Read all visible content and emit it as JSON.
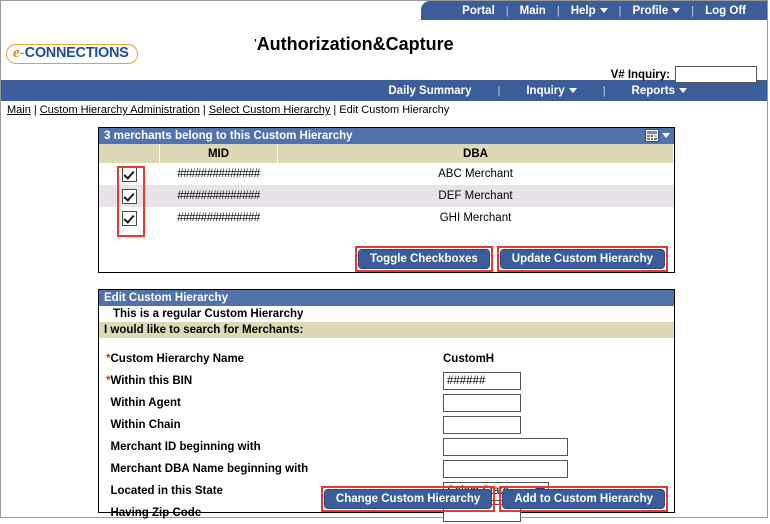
{
  "topnav": {
    "items": [
      {
        "label": "Portal",
        "caret": false
      },
      {
        "label": "Main",
        "caret": false
      },
      {
        "label": "Help",
        "caret": true
      },
      {
        "label": "Profile",
        "caret": true
      },
      {
        "label": "Log Off",
        "caret": false
      }
    ],
    "separator": "|"
  },
  "brand": {
    "logo_prefix": "e-",
    "logo_word": "CONNECTIONS",
    "title_tick": "'",
    "title": "Authorization&Capture",
    "vinquiry_label": "V# Inquiry:",
    "vinquiry_value": "",
    "vinquiry_placeholder": ""
  },
  "subnav": {
    "items": [
      {
        "label": "Daily Summary",
        "caret": false
      },
      {
        "label": "Inquiry",
        "caret": true
      },
      {
        "label": "Reports",
        "caret": true
      }
    ],
    "separator": "|"
  },
  "breadcrumb": {
    "links": [
      "Main",
      "Custom Hierarchy Administration",
      "Select Custom Hierarchy"
    ],
    "current": "Edit Custom Hierarchy",
    "separator": "|"
  },
  "merchants": {
    "panel_title": "3 merchants belong to this Custom Hierarchy",
    "grid_icon": "grid-view-icon",
    "columns": [
      "",
      "MID",
      "DBA"
    ],
    "rows": [
      {
        "checked": true,
        "mid": "##############",
        "dba": "ABC Merchant"
      },
      {
        "checked": true,
        "mid": "##############",
        "dba": "DEF Merchant"
      },
      {
        "checked": true,
        "mid": "##############",
        "dba": "GHI Merchant"
      }
    ],
    "toggle_button": "Toggle Checkboxes",
    "update_button": "Update Custom Hierarchy"
  },
  "edit": {
    "panel_title": "Edit Custom Hierarchy",
    "subtitle": "This is a regular Custom Hierarchy",
    "search_band": "I would like to search for Merchants:",
    "fields": [
      {
        "label": "Custom Hierarchy Name",
        "required": true,
        "type": "text-value",
        "value": "CustomH"
      },
      {
        "label": "Within this BIN",
        "required": true,
        "type": "input-sm",
        "value": "######"
      },
      {
        "label": "Within Agent",
        "required": false,
        "type": "input-sm",
        "value": ""
      },
      {
        "label": "Within Chain",
        "required": false,
        "type": "input-sm",
        "value": ""
      },
      {
        "label": "Merchant ID beginning with",
        "required": false,
        "type": "input-lg",
        "value": ""
      },
      {
        "label": "Merchant DBA Name beginning with",
        "required": false,
        "type": "input-lg",
        "value": ""
      },
      {
        "label": "Located in this State",
        "required": false,
        "type": "select",
        "value": "Select State"
      },
      {
        "label": "Having Zip Code",
        "required": false,
        "type": "input-sm",
        "value": ""
      }
    ],
    "change_button": "Change Custom Hierarchy",
    "add_button": "Add to Custom Hierarchy"
  },
  "colors": {
    "nav_blue": "#3b5e9b",
    "panel_title_blue": "#5172ab",
    "band_tan": "#dcd9b4",
    "annotation_red": "#e8392e",
    "required_red": "#e03018",
    "logo_orange": "#e8850c",
    "logo_blue": "#1f4e96",
    "row_alt": "#e9e3e9"
  }
}
